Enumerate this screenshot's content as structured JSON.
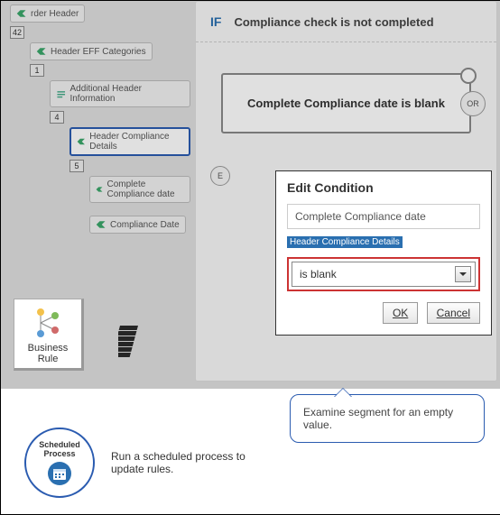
{
  "tree": {
    "root": "rder Header",
    "root_badge": "42",
    "n1": "Header EFF Categories",
    "n1_badge": "1",
    "n2": "Additional Header Information",
    "n2_badge": "4",
    "n3": "Header Compliance Details",
    "n3_badge": "5",
    "n4": "Complete Compliance date",
    "n5": "Compliance Date"
  },
  "canvas": {
    "if_label": "IF",
    "if_desc": "Compliance check is not completed",
    "cond_text": "Complete Compliance date is blank",
    "or": "OR",
    "e": "E"
  },
  "pop": {
    "title": "Edit Condition",
    "field": "Complete Compliance date",
    "sublabel": "Header Compliance Details",
    "operator": "is blank",
    "ok": "OK",
    "cancel": "Cancel"
  },
  "brtile": "Business Rule",
  "callout": "Examine segment for an empty value.",
  "sched": {
    "ring_line1": "Scheduled",
    "ring_line2": "Process",
    "text": "Run a scheduled process to update rules."
  }
}
